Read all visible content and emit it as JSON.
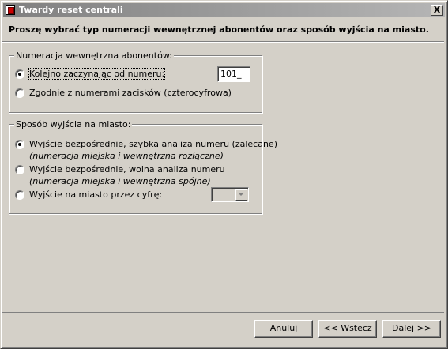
{
  "window": {
    "title": "Twardy reset centrali",
    "close_label": "X"
  },
  "instruction": "Proszę wybrać typ numeracji wewnętrznej abonentów oraz sposób wyjścia na miasto.",
  "numbering": {
    "label": "Numeracja wewnętrzna abonentów:",
    "option_sequential": "Kolejno zaczynając od numeru:",
    "start_number": "101_",
    "option_terminals": "Zgodnie z numerami zacisków (czterocyfrowa)",
    "selected": "sequential"
  },
  "outside": {
    "label": "Sposób wyjścia na miasto:",
    "option_fast": "Wyjście bezpośrednie, szybka analiza numeru (zalecane)",
    "option_fast_note": "(numeracja miejska i wewnętrzna rozłączne)",
    "option_slow": "Wyjście bezpośrednie, wolna analiza numeru",
    "option_slow_note": "(numeracja miejska i wewnętrzna spójne)",
    "option_digit": "Wyjście na miasto przez cyfrę:",
    "digit_value": "",
    "selected": "fast"
  },
  "buttons": {
    "cancel": "Anuluj",
    "back": "<< Wstecz",
    "next": "Dalej >>"
  }
}
